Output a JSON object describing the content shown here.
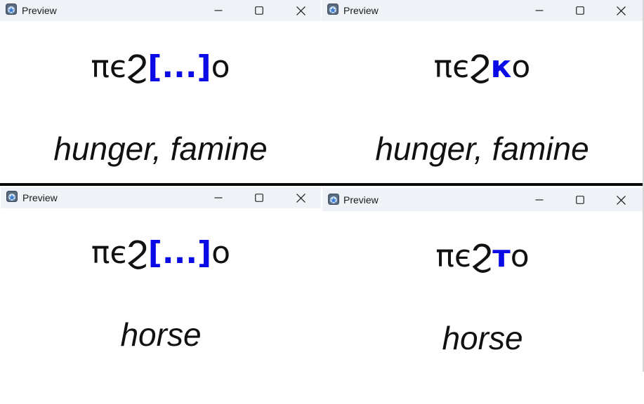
{
  "accent_color": "#0a0ae6",
  "windows": [
    {
      "title": "Preview",
      "word_before": "πєϨ",
      "word_highlight": "[...]",
      "word_after": "o",
      "gloss": "hunger, famine"
    },
    {
      "title": "Preview",
      "word_before": "πєϨ",
      "word_highlight": "к",
      "word_after": "o",
      "gloss": "hunger, famine"
    },
    {
      "title": "Preview",
      "word_before": "πєϨ",
      "word_highlight": "[...]",
      "word_after": "o",
      "gloss": "horse"
    },
    {
      "title": "Preview",
      "word_before": "πєϨ",
      "word_highlight": "т",
      "word_after": "o",
      "gloss": "horse"
    }
  ]
}
